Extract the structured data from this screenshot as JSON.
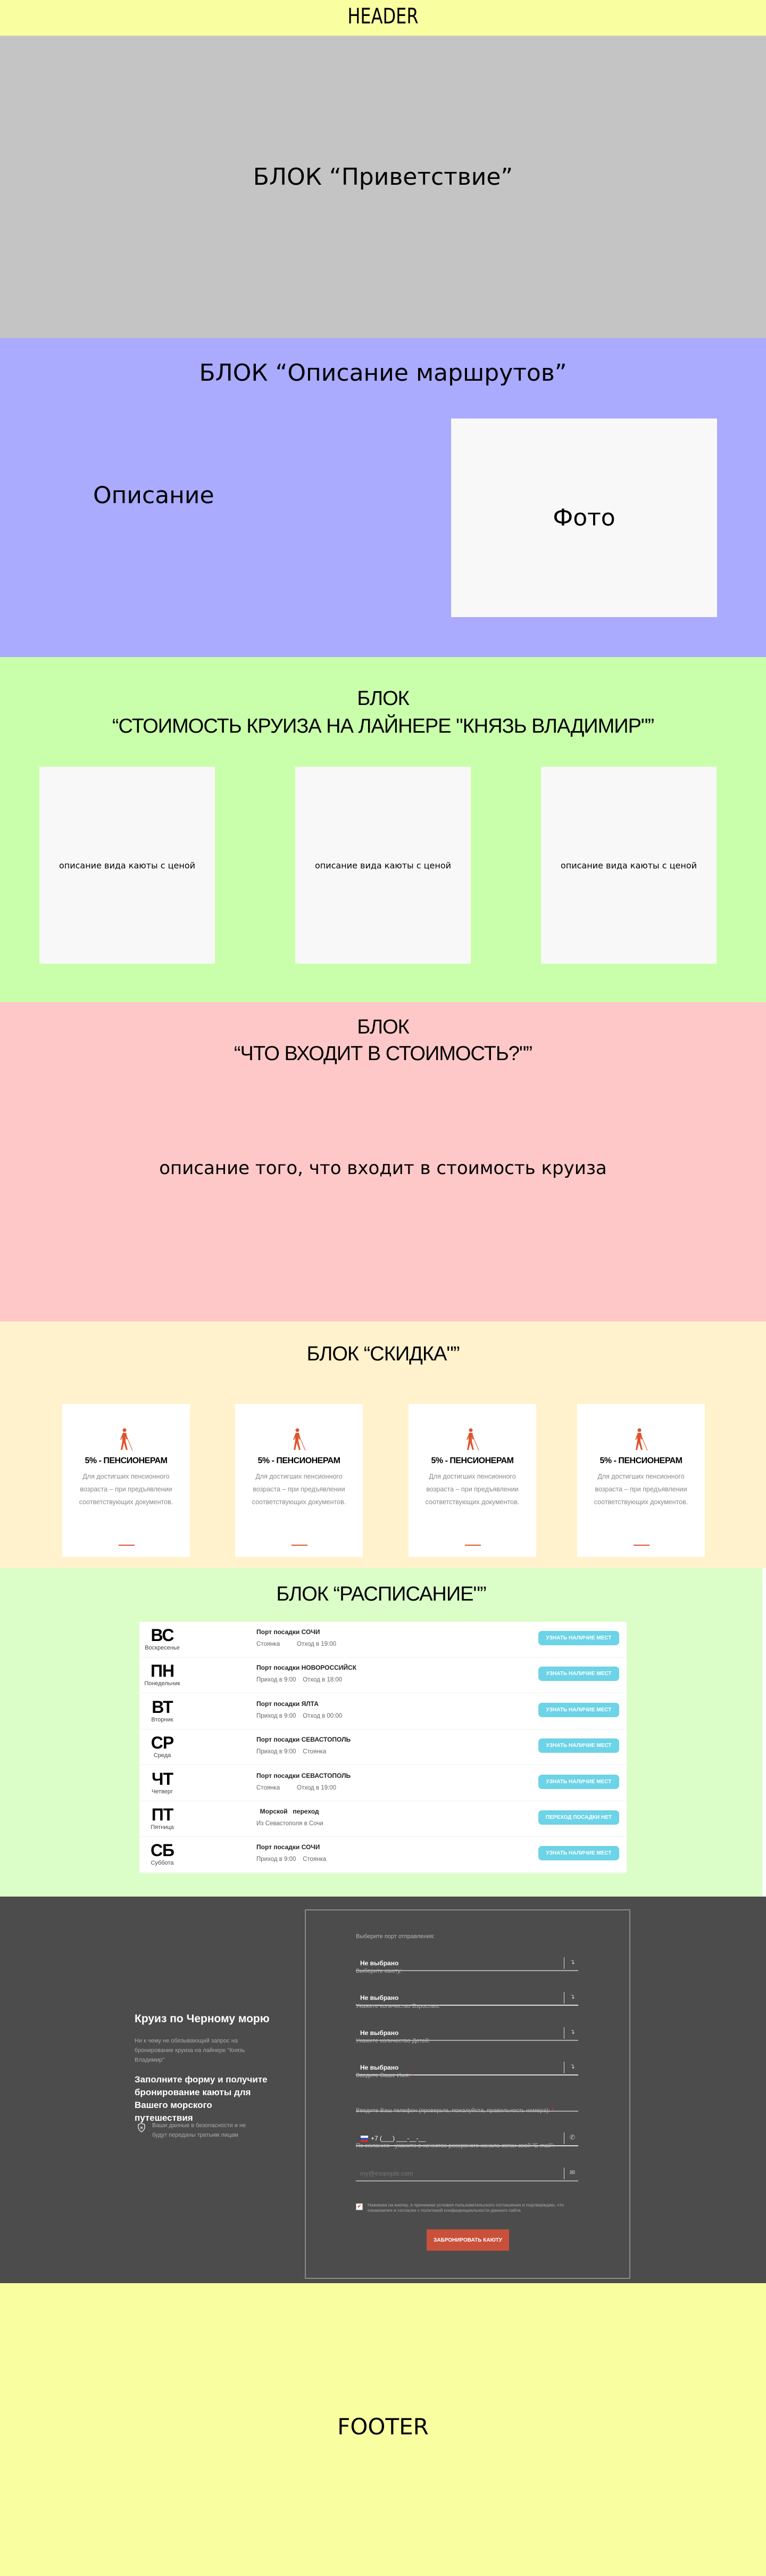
{
  "header": {
    "label": "HEADER"
  },
  "greeting": {
    "title": "БЛОК “Приветствие”"
  },
  "routes": {
    "title": "БЛОК “Описание маршрутов”",
    "description": "Описание",
    "photo": "Фото"
  },
  "cost": {
    "title_line1": "БЛОК",
    "title_line2": "“СТОИМОСТЬ КРУИЗА НА ЛАЙНЕРЕ \"КНЯЗЬ ВЛАДИМИР\"”",
    "cards": [
      "описание вида каюты с ценой",
      "описание вида каюты с ценой",
      "описание вида каюты с ценой"
    ]
  },
  "includes": {
    "title_line1": "БЛОК",
    "title_line2": "“ЧТО ВХОДИТ В СТОИМОСТЬ?\"”",
    "body": "описание того, что входит в стоимость круиза"
  },
  "discount": {
    "title": "БЛОК “СКИДКА\"”",
    "accent": "#e0532f",
    "cards": [
      {
        "icon": "blind-person-icon",
        "title": "5% - ПЕНСИОНЕРАМ",
        "text": "Для достигших пенсионного возраста – при предъявлении соответствующих документов."
      },
      {
        "icon": "blind-person-icon",
        "title": "5% - ПЕНСИОНЕРАМ",
        "text": "Для достигших пенсионного возраста – при предъявлении соответствующих документов."
      },
      {
        "icon": "blind-person-icon",
        "title": "5% - ПЕНСИОНЕРАМ",
        "text": "Для достигших пенсионного возраста – при предъявлении соответствующих документов."
      },
      {
        "icon": "blind-person-icon",
        "title": "5% - ПЕНСИОНЕРАМ",
        "text": "Для достигших пенсионного возраста – при предъявлении соответствующих документов."
      }
    ]
  },
  "schedule": {
    "title": "БЛОК “РАСПИСАНИЕ\"”",
    "rows": [
      {
        "abbr": "ВС",
        "day": "Воскресенье",
        "port": "Порт посадки СОЧИ",
        "times": "Стоянка          Отход в 19:00",
        "button": "УЗНАТЬ НАЛИЧИЕ МЕСТ"
      },
      {
        "abbr": "ПН",
        "day": "Понедельник",
        "port": "Порт посадки НОВОРОССИЙСК",
        "times": "Приход в 9:00    Отход в 18:00",
        "button": "УЗНАТЬ НАЛИЧИЕ МЕСТ"
      },
      {
        "abbr": "ВТ",
        "day": "Вторник",
        "port": "Порт посадки ЯЛТА",
        "times": "Приход в 9:00    Отход в 00:00",
        "button": "УЗНАТЬ НАЛИЧИЕ МЕСТ"
      },
      {
        "abbr": "СР",
        "day": "Среда",
        "port": "Порт посадки СЕВАСТОПОЛЬ",
        "times": "Приход в 9:00    Стоянка",
        "button": "УЗНАТЬ НАЛИЧИЕ МЕСТ"
      },
      {
        "abbr": "ЧТ",
        "day": "Четверг",
        "port": "Порт посадки СЕВАСТОПОЛЬ",
        "times": "Стоянка          Отход в 19:00",
        "button": "УЗНАТЬ НАЛИЧИЕ МЕСТ"
      },
      {
        "abbr": "ПТ",
        "day": "Пятница",
        "port": "  Морской   переход",
        "times": "Из Севастополя в Сочи",
        "button": "ПЕРЕХОД ПОСАДКИ НЕТ"
      },
      {
        "abbr": "СБ",
        "day": "Суббота",
        "port": "Порт посадки СОЧИ",
        "times": "Приход в 9:00    Стоянка",
        "button": "УЗНАТЬ НАЛИЧИЕ МЕСТ"
      }
    ]
  },
  "booking": {
    "title": "Круиз по Черному морю",
    "subtitle": "Ни к чему не обязывающий запрос на бронирование круиза на лайнере \"Князь Владимир\"",
    "heading": "Заполните форму и получите бронирование каюты для Вашего морского путешествия",
    "security": "Ваши данные в безопасности и не будут переданы третьим лицам",
    "fields": {
      "port": {
        "label": "Выберите порт отправления:",
        "value": "Не выбрано"
      },
      "cabin": {
        "label": "Выберите каюту:",
        "value": "Не выбрано"
      },
      "adults": {
        "label": "Укажите количество Взрослых:",
        "value": "Не выбрано"
      },
      "children": {
        "label": "Укажите количество Детей:",
        "value": "Не выбрано"
      },
      "name": {
        "label": "Введите Ваше Имя:",
        "required": "*"
      },
      "phone": {
        "label": "Введите Ваш телефон (проверьте, пожалуйста, правильность номера):",
        "required": "*",
        "value": "+7 (___) ___-__-__"
      },
      "email": {
        "label": "По желанию - укажите в качестве резервного канала связи свой \"E-mail\":",
        "placeholder": "my@example.com"
      }
    },
    "consent": "Нажимая на кнопку, я принимаю условия пользовательского соглашения и подтверждаю, что ознакомлен и согласен с политикой конфиденциальности данного сайта.",
    "submit": "ЗАБРОНИРОВАТЬ КАЮТУ"
  },
  "footer": {
    "label": "FOOTER"
  }
}
